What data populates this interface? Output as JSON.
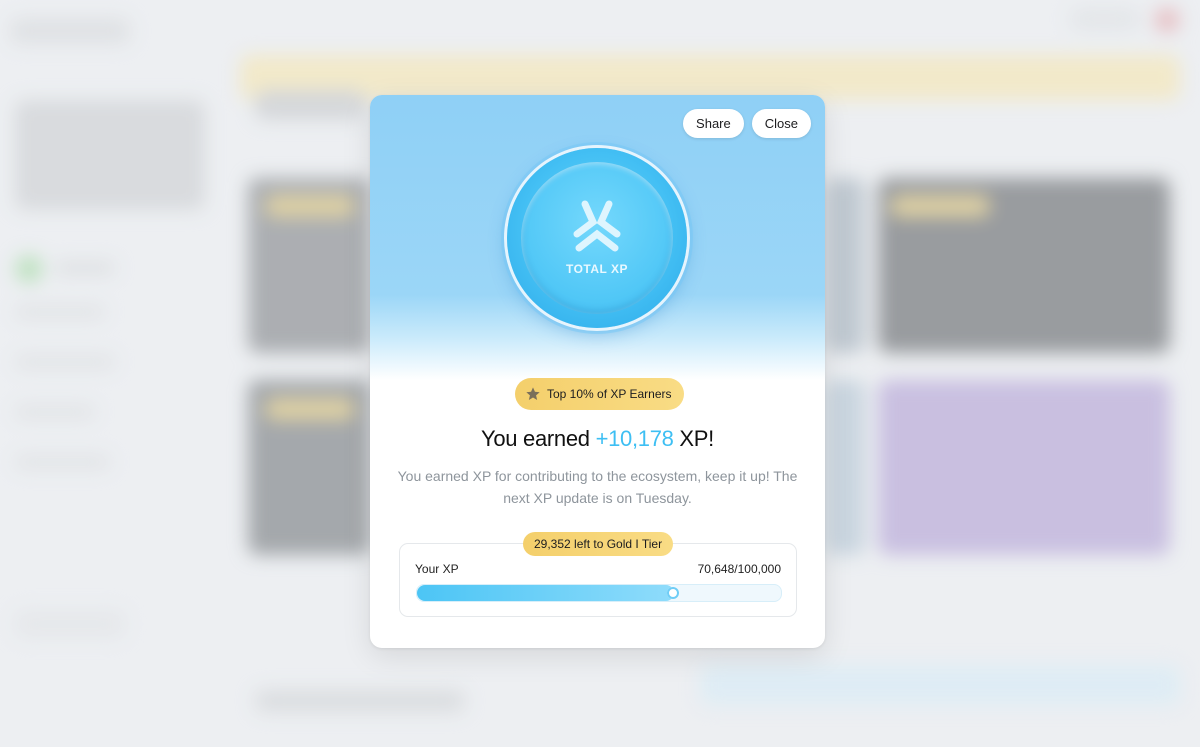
{
  "modal": {
    "share_label": "Share",
    "close_label": "Close",
    "coin_label": "TOTAL XP",
    "badge_label": "Top 10% of XP Earners",
    "headline_prefix": "You earned ",
    "headline_amount": "+10,178",
    "headline_suffix": " XP!",
    "description": "You earned XP for contributing to the ecosystem, keep it up! The next XP update is on Tuesday.",
    "tier_label": "29,352 left to Gold I Tier",
    "xp_label": "Your XP",
    "xp_value": "70,648/100,000",
    "progress_fraction": 0.70648
  },
  "colors": {
    "accent": "#3ebff3",
    "gold": "#f4cf6b",
    "hero_blue": "#9bd6f7"
  },
  "icons": {
    "coin_logo": "total-xp-logo-icon",
    "badge_icon": "star-icon"
  }
}
